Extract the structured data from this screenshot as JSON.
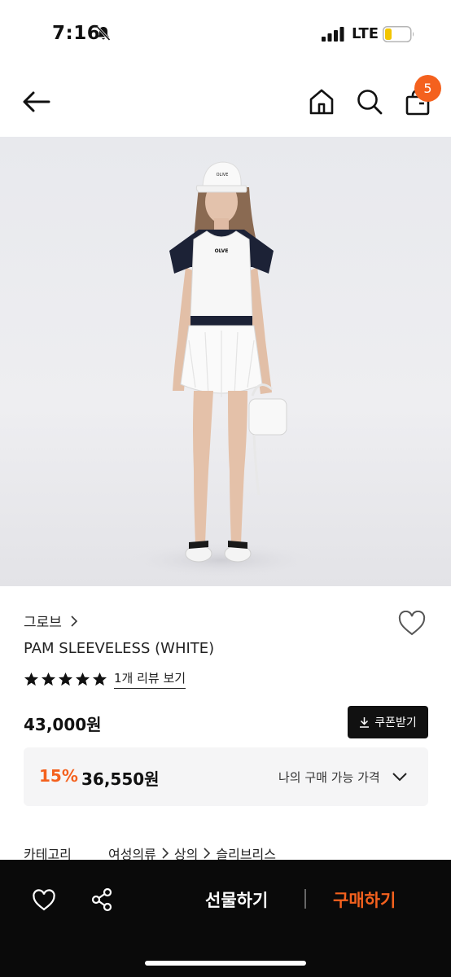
{
  "status_bar": {
    "time": "7:16",
    "network": "LTE"
  },
  "nav": {
    "cart_count": "5"
  },
  "product": {
    "model_cap_text": "OLIVE",
    "model_top_logo": "OLVE",
    "brand": "그로브",
    "title": "PAM SLEEVELESS (WHITE)",
    "rating": 5,
    "review_link": "1개 리뷰 보기",
    "price": "43,000원",
    "coupon_label": "쿠폰받기",
    "discount_percent": "15%",
    "discount_price": "36,550원",
    "my_price_label": "나의 구매 가능 가격",
    "category_label": "카테고리",
    "category_path": [
      "여성의류",
      "상의",
      "슬리브리스"
    ]
  },
  "bottom_bar": {
    "gift_label": "선물하기",
    "buy_label": "구매하기"
  },
  "colors": {
    "accent": "#f4611e",
    "bottom_bar_bg": "#0a0a0a"
  }
}
